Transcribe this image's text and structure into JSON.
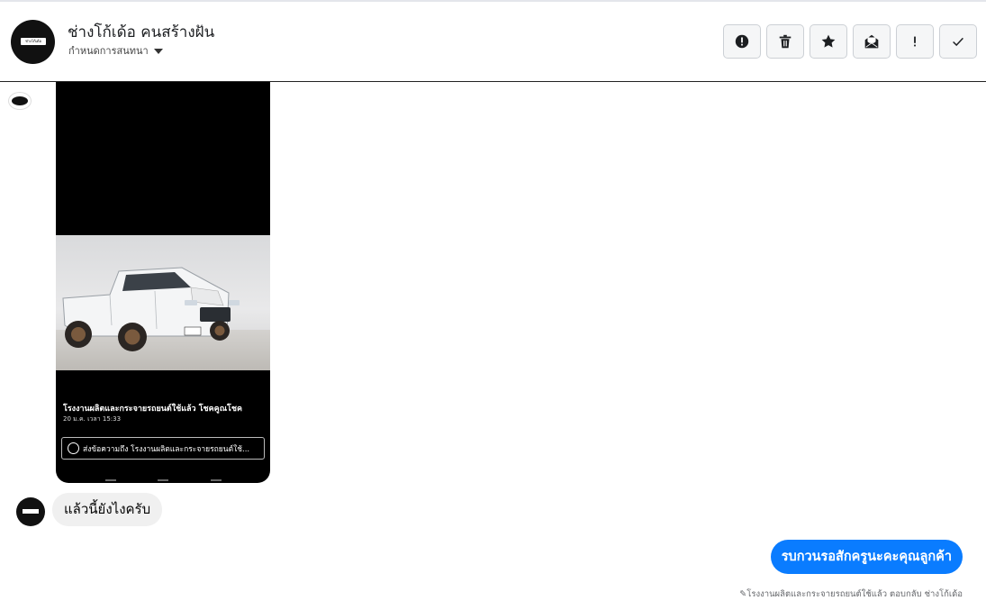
{
  "header": {
    "avatar_text": "ช่างโก้เด้อ",
    "name": "ช่างโก้เด้อ คนสร้างฝัน",
    "assign_label": "กำหนดการสนทนา",
    "actions": [
      {
        "name": "report-spam-button",
        "icon": "alert-circle-icon"
      },
      {
        "name": "delete-button",
        "icon": "trash-icon"
      },
      {
        "name": "star-button",
        "icon": "star-icon"
      },
      {
        "name": "mark-unread-button",
        "icon": "envelope-open-icon"
      },
      {
        "name": "follow-up-button",
        "icon": "exclamation-icon"
      },
      {
        "name": "done-button",
        "icon": "check-icon"
      }
    ]
  },
  "shared_ad": {
    "title": "โรงงานผลิตและกระจายรถยนต์ใช้แล้ว โชคคูณโชค",
    "date": "20 ม.ค. เวลา 15:33",
    "cta": "ส่งข้อความถึง โรงงานผลิตและกระจายรถยนต์ใช้..."
  },
  "messages": {
    "incoming_text": "แล้วนี้ยังไงครับ",
    "outgoing_text": "รบกวนรอสักครูนะคะคุณลูกค้า",
    "footnote": "โรงงานผลิตและกระจายรถยนต์ใช้แล้ว ตอบกลับ ช่างโก้เด้อ"
  },
  "colors": {
    "accent": "#0a7cff",
    "incoming_bubble": "#f0f0f0"
  }
}
